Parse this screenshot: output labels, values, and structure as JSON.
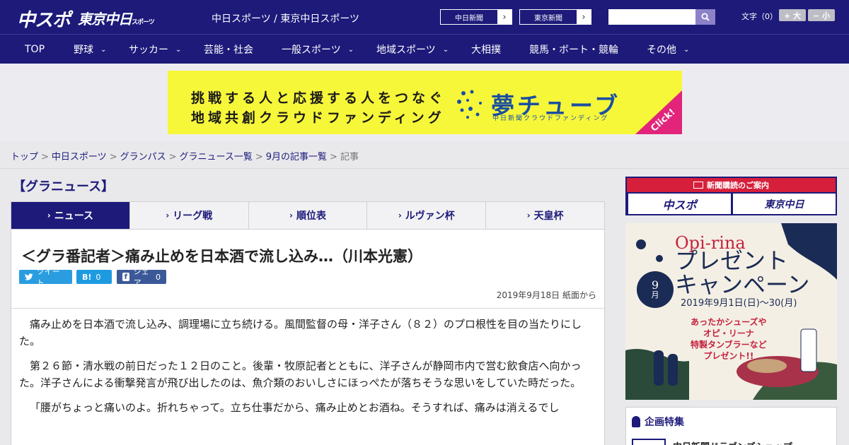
{
  "header": {
    "logo_main": "中スポ",
    "logo_tokyo": "東京中日",
    "logo_tokyo_sub": "スポーツ",
    "site_title": "中日スポーツ / 東京中日スポーツ",
    "ext_links": [
      "中日新聞",
      "東京新聞"
    ],
    "font_size_label": "文字（0）",
    "font_plus": "+ 大",
    "font_minus": "− 小"
  },
  "nav": {
    "items": [
      {
        "label": "TOP",
        "dropdown": false
      },
      {
        "label": "野球",
        "dropdown": true
      },
      {
        "label": "サッカー",
        "dropdown": true
      },
      {
        "label": "芸能・社会",
        "dropdown": false
      },
      {
        "label": "一般スポーツ",
        "dropdown": true
      },
      {
        "label": "地域スポーツ",
        "dropdown": true
      },
      {
        "label": "大相撲",
        "dropdown": false
      },
      {
        "label": "競馬・ボート・競輪",
        "dropdown": false
      },
      {
        "label": "その他",
        "dropdown": true
      }
    ]
  },
  "banner": {
    "line1": "挑戦する人と応援する人をつなぐ",
    "line2": "地域共創クラウドファンディング",
    "brand": "夢チューブ",
    "sub": "中日新聞クラウドファンディング",
    "click": "Click!"
  },
  "breadcrumb": {
    "items": [
      "トップ",
      "中日スポーツ",
      "グランパス",
      "グラニュース一覧",
      "9月の記事一覧"
    ],
    "current": "記事",
    "separator": ">"
  },
  "section": {
    "title": "【グラニュース】"
  },
  "tabs": [
    {
      "label": "ニュース",
      "active": true
    },
    {
      "label": "リーグ戦",
      "active": false
    },
    {
      "label": "順位表",
      "active": false
    },
    {
      "label": "ルヴァン杯",
      "active": false
    },
    {
      "label": "天皇杯",
      "active": false
    }
  ],
  "article": {
    "headline": "＜グラ番記者＞痛み止めを日本酒で流し込み…（川本光憲）",
    "share": {
      "tweet": "ツイート",
      "hatena_icon": "B!",
      "hatena_count": "0",
      "facebook": "シェア",
      "facebook_count": "0"
    },
    "date": "2019年9月18日 紙面から",
    "paragraphs": [
      "痛み止めを日本酒で流し込み、調理場に立ち続ける。風間監督の母・洋子さん（８２）のプロ根性を目の当たりにした。",
      "第２６節・清水戦の前日だった１２日のこと。後輩・牧原記者とともに、洋子さんが静岡市内で営む飲食店へ向かった。洋子さんによる衝撃発言が飛び出したのは、魚介類のおいしさにほっぺたが落ちそうな思いをしていた時だった。",
      "「腰がちょっと痛いのよ。折れちゃって。立ち仕事だから、痛み止めとお酒ね。そうすれば、痛みは消えるでし"
    ]
  },
  "sidebar": {
    "subscribe_head": "新聞購読のご案内",
    "subscribe_logos": [
      "中スポ",
      "東京中日"
    ],
    "promo": {
      "brand": "Opi-rina",
      "title_1": "プレゼント",
      "title_2": "キャンペーン",
      "month_num": "9",
      "month_unit": "月",
      "date": "2019年9月1日(日)〜30(月)",
      "copy_1": "あったかシューズや",
      "copy_2": "オピ・リーナ",
      "copy_3": "特製タンブラーなど",
      "copy_4": "プレゼント!!"
    },
    "feature_title": "企画特集",
    "feature_item": "中日新聞ドラゴンズショップ"
  },
  "colors": {
    "brand_navy": "#1d1a7a",
    "banner_yellow": "#f7f73a",
    "accent_red": "#d6203b",
    "twitter": "#2a9de0",
    "facebook": "#3b5998"
  }
}
